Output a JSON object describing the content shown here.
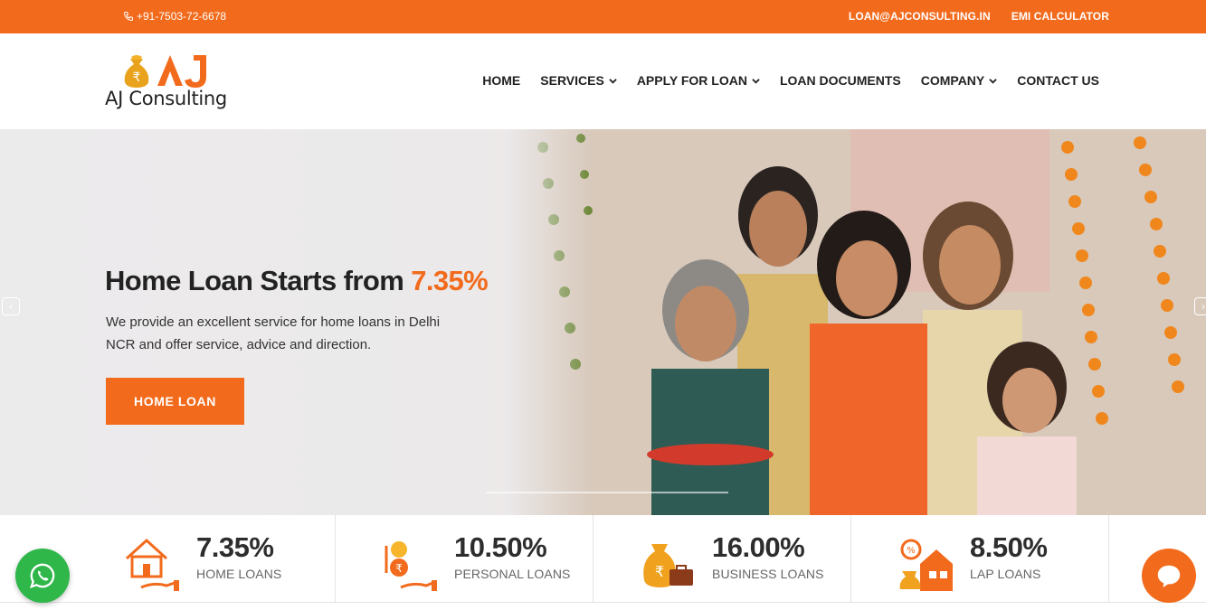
{
  "topbar": {
    "phone": "+91-7503-72-6678",
    "email": "LOAN@AJCONSULTING.IN",
    "emi": "EMI CALCULATOR"
  },
  "brand": {
    "name": "AJ Consulting",
    "mark": "AJ"
  },
  "nav": {
    "home": "HOME",
    "services": "SERVICES",
    "apply": "APPLY FOR LOAN",
    "documents": "LOAN DOCUMENTS",
    "company": "COMPANY",
    "contact": "CONTACT US"
  },
  "hero": {
    "title": "Home Loan Starts from ",
    "title_rate": "7.35%",
    "description": "We provide an excellent service for home loans in Delhi NCR and offer service, advice and direction.",
    "cta": "HOME LOAN"
  },
  "rates": [
    {
      "value": "7.35%",
      "label": "HOME LOANS",
      "icon": "house-hand-icon"
    },
    {
      "value": "10.50%",
      "label": "PERSONAL LOANS",
      "icon": "rupee-coin-hand-icon"
    },
    {
      "value": "16.00%",
      "label": "BUSINESS LOANS",
      "icon": "money-bag-briefcase-icon"
    },
    {
      "value": "8.50%",
      "label": "LAP LOANS",
      "icon": "property-loan-icon"
    }
  ],
  "colors": {
    "accent": "#f26b1d",
    "whatsapp": "#2fb74a",
    "text": "#222222"
  }
}
